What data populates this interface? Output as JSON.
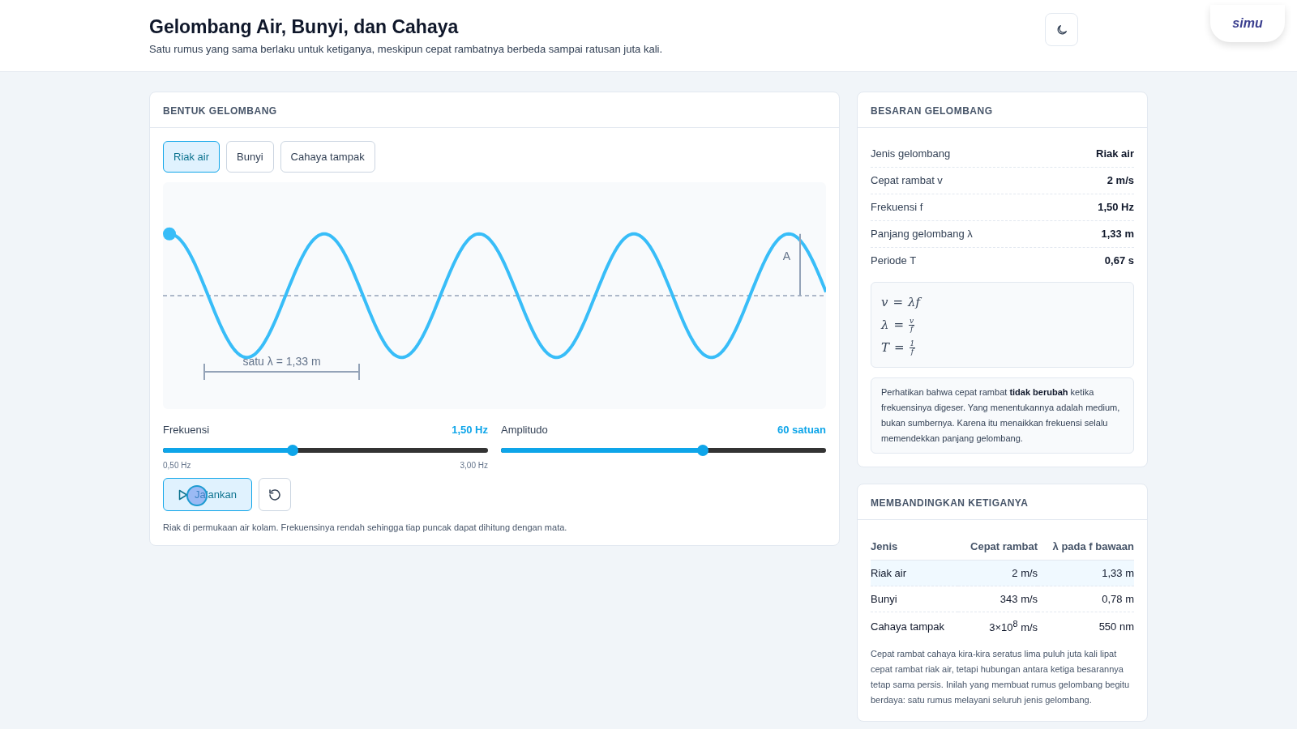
{
  "header": {
    "title": "Gelombang Air, Bunyi, dan Cahaya",
    "subtitle": "Satu rumus yang sama berlaku untuk ketiganya, meskipun cepat rambatnya berbeda sampai ratusan juta kali.",
    "logo": "simu"
  },
  "wave_panel": {
    "title": "BENTUK GELOMBANG",
    "tabs": [
      {
        "label": "Riak air",
        "selected": true
      },
      {
        "label": "Bunyi",
        "selected": false
      },
      {
        "label": "Cahaya tampak",
        "selected": false
      }
    ],
    "wave": {
      "amplitude_label": "A",
      "wavelength_label": "satu λ = 1,33 m"
    },
    "sliders": [
      {
        "label": "Frekuensi",
        "reading": "1,50 Hz",
        "level": 0.4,
        "min_label": "0,50 Hz",
        "max_label": "3,00 Hz"
      },
      {
        "label": "Amplitudo",
        "reading": "60 satuan",
        "level": 0.62
      }
    ],
    "run_button": {
      "label": "Jalankan"
    },
    "note": "Riak di permukaan air kolam. Frekuensinya rendah sehingga tiap puncak dapat dihitung dengan mata."
  },
  "quantities_panel": {
    "title": "BESARAN GELOMBANG",
    "rows": [
      {
        "label": "Jenis gelombang",
        "value": "Riak air"
      },
      {
        "label": "Cepat rambat v",
        "value": "2 m/s"
      },
      {
        "label": "Frekuensi f",
        "value": "1,50 Hz"
      },
      {
        "label": "Panjang gelombang λ",
        "value": "1,33 m"
      },
      {
        "label": "Periode T",
        "value": "0,67 s"
      }
    ],
    "formulas": [
      {
        "kind": "plain",
        "lhs": "v",
        "eq": "=",
        "rhs": "λf"
      },
      {
        "kind": "fraction",
        "lhs": "λ",
        "eq": "=",
        "num": "v",
        "den": "f"
      },
      {
        "kind": "fraction",
        "lhs": "T",
        "eq": "=",
        "num": "1",
        "den": "f"
      }
    ],
    "note": "Perhatikan bahwa cepat rambat **tidak berubah** ketika frekuensinya digeser. Yang menentukannya adalah medium, bukan sumbernya. Karena itu menaikkan frekuensi selalu memendekkan panjang gelombang."
  },
  "compare_panel": {
    "title": "MEMBANDINGKAN KETIGANYA",
    "columns": [
      "Jenis",
      "Cepat rambat",
      "λ pada f bawaan"
    ],
    "rows": [
      {
        "cells": [
          "Riak air",
          "2 m/s",
          "1,33 m"
        ],
        "selected": true
      },
      {
        "cells": [
          "Bunyi",
          "343 m/s",
          "0,78 m"
        ],
        "selected": false
      },
      {
        "cells": [
          "Cahaya tampak",
          "3×10$^{8}$ m/s",
          "550 nm"
        ],
        "selected": false
      }
    ],
    "note": "Cepat rambat cahaya kira-kira seratus lima puluh juta kali lipat cepat rambat riak air, tetapi hubungan antara ketiga besarannya tetap sama persis. Inilah yang membuat rumus gelombang begitu berdaya: satu rumus melayani seluruh jenis gelombang."
  }
}
